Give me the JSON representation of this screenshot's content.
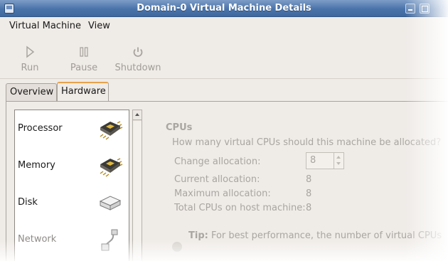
{
  "window": {
    "title": "Domain-0 Virtual Machine Details"
  },
  "menubar": {
    "virtual_machine": "Virtual Machine",
    "view": "View"
  },
  "toolbar": {
    "run_label": "Run",
    "pause_label": "Pause",
    "shutdown_label": "Shutdown"
  },
  "tabs": {
    "overview": "Overview",
    "hardware": "Hardware",
    "selected": "Hardware"
  },
  "hardware_list": [
    {
      "label": "Processor",
      "icon": "processor-chip-icon"
    },
    {
      "label": "Memory",
      "icon": "memory-chip-icon"
    },
    {
      "label": "Disk",
      "icon": "disk-drive-icon"
    },
    {
      "label": "Network",
      "icon": "network-cable-icon"
    }
  ],
  "cpus": {
    "heading": "CPUs",
    "question": "How many virtual CPUs should this machine be allocated?",
    "change_allocation_label": "Change allocation:",
    "change_allocation_value": "8",
    "current_allocation_label": "Current allocation:",
    "current_allocation_value": "8",
    "maximum_allocation_label": "Maximum allocation:",
    "maximum_allocation_value": "8",
    "total_cpus_label": "Total CPUs on host machine:",
    "total_cpus_value": "8",
    "tip_bold": "Tip:",
    "tip_text": "For best performance, the number of virtual CPUs"
  },
  "colors": {
    "titlebar": "#4a73aa",
    "window_bg": "#efebe7",
    "active_tab_accent": "#e8a14c"
  }
}
